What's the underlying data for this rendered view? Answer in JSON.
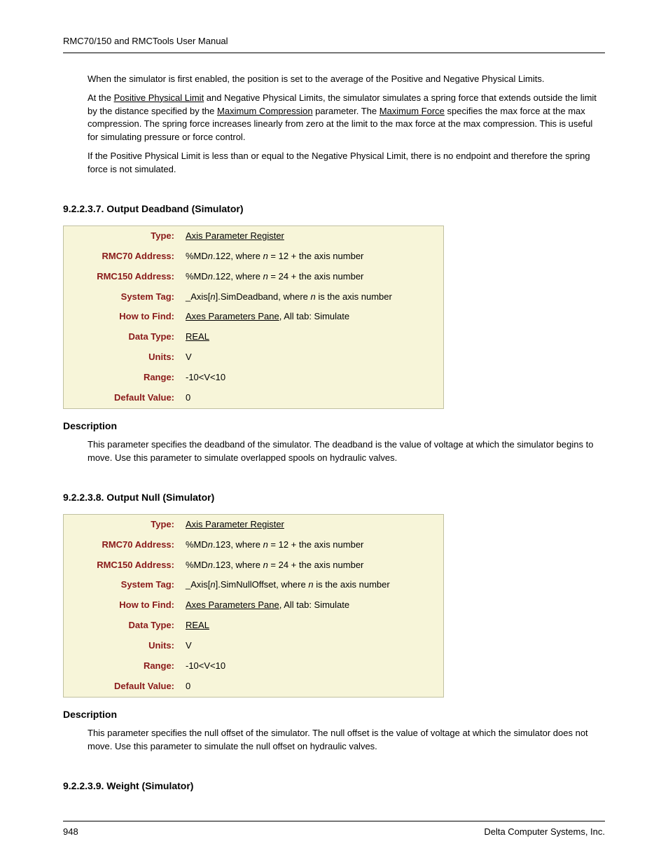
{
  "header": "RMC70/150 and RMCTools User Manual",
  "intro": {
    "p1": "When the simulator is first enabled, the position is set to the average of the Positive and Negative Physical Limits.",
    "p2a": "At the ",
    "p2_link1": "Positive Physical Limit",
    "p2b": " and Negative Physical Limits, the simulator simulates a spring force that extends outside the limit by the distance specified by the ",
    "p2_link2": "Maximum Compression",
    "p2c": " parameter. The ",
    "p2_link3": "Maximum Force",
    "p2d": " specifies the max force at the max compression. The spring force increases linearly from zero at the limit to the max force at the max compression. This is useful for simulating pressure or force control.",
    "p3": "If the Positive Physical Limit is less than or equal to the Negative Physical Limit, there is no endpoint and therefore the spring force is not simulated."
  },
  "section1": {
    "heading": "9.2.2.3.7. Output Deadband (Simulator)",
    "labels": {
      "type": "Type:",
      "rmc70": "RMC70 Address:",
      "rmc150": "RMC150 Address:",
      "systag": "System Tag:",
      "howto": "How to Find:",
      "dtype": "Data Type:",
      "units": "Units:",
      "range": "Range:",
      "default": "Default Value:"
    },
    "values": {
      "type_link": "Axis Parameter Register",
      "rmc70_a": "%MD",
      "rmc70_n": "n",
      "rmc70_b": ".122, where ",
      "rmc70_c": " = 12 + the axis number",
      "rmc150_a": "%MD",
      "rmc150_n": "n",
      "rmc150_b": ".122, where ",
      "rmc150_c": " = 24 + the axis number",
      "systag_a": "_Axis[",
      "systag_n": "n",
      "systag_b": "].SimDeadband, where ",
      "systag_c": " is the axis number",
      "howto_link": "Axes Parameters Pane",
      "howto_rest": ", All tab: Simulate",
      "dtype_link": "REAL",
      "units": "V",
      "range": "-10<V<10",
      "default": "0"
    },
    "desc_heading": "Description",
    "desc": "This parameter specifies the deadband of the simulator. The deadband is the value of voltage at which the simulator begins to move. Use this parameter to simulate overlapped spools on hydraulic valves."
  },
  "section2": {
    "heading": "9.2.2.3.8. Output Null (Simulator)",
    "labels": {
      "type": "Type:",
      "rmc70": "RMC70 Address:",
      "rmc150": "RMC150 Address:",
      "systag": "System Tag:",
      "howto": "How to Find:",
      "dtype": "Data Type:",
      "units": "Units:",
      "range": "Range:",
      "default": "Default Value:"
    },
    "values": {
      "type_link": "Axis Parameter Register",
      "rmc70_a": "%MD",
      "rmc70_n": "n",
      "rmc70_b": ".123, where ",
      "rmc70_c": " = 12 + the axis number",
      "rmc150_a": "%MD",
      "rmc150_n": "n",
      "rmc150_b": ".123, where ",
      "rmc150_c": " = 24 + the axis number",
      "systag_a": "_Axis[",
      "systag_n": "n",
      "systag_b": "].SimNullOffset, where ",
      "systag_c": " is the axis number",
      "howto_link": "Axes Parameters Pane",
      "howto_rest": ", All tab: Simulate",
      "dtype_link": "REAL",
      "units": "V",
      "range": "-10<V<10",
      "default": "0"
    },
    "desc_heading": "Description",
    "desc": "This parameter specifies the null offset of the simulator. The null offset is the value of voltage at which the simulator does not move. Use this parameter to simulate the null offset on hydraulic valves."
  },
  "section3": {
    "heading": "9.2.2.3.9. Weight (Simulator)"
  },
  "footer": {
    "page": "948",
    "company": "Delta Computer Systems, Inc."
  }
}
